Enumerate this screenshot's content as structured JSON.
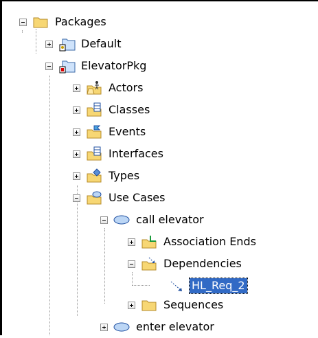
{
  "tree": {
    "nodes": [
      {
        "label": "Packages",
        "toggle": "minus",
        "icon": "folder-icon"
      },
      {
        "label": "Default",
        "toggle": "plus",
        "icon": "package-icon"
      },
      {
        "label": "ElevatorPkg",
        "toggle": "minus",
        "icon": "package-icon"
      },
      {
        "label": "Actors",
        "toggle": "plus",
        "icon": "actors-folder-icon"
      },
      {
        "label": "Classes",
        "toggle": "plus",
        "icon": "classes-folder-icon"
      },
      {
        "label": "Events",
        "toggle": "plus",
        "icon": "events-folder-icon"
      },
      {
        "label": "Interfaces",
        "toggle": "plus",
        "icon": "interfaces-folder-icon"
      },
      {
        "label": "Types",
        "toggle": "plus",
        "icon": "types-folder-icon"
      },
      {
        "label": "Use Cases",
        "toggle": "minus",
        "icon": "usecases-folder-icon"
      },
      {
        "label": "call elevator",
        "toggle": "minus",
        "icon": "usecase-icon"
      },
      {
        "label": "Association Ends",
        "toggle": "plus",
        "icon": "association-ends-folder-icon"
      },
      {
        "label": "Dependencies",
        "toggle": "minus",
        "icon": "dependencies-folder-icon"
      },
      {
        "label": "HL_Req_2",
        "toggle": "none",
        "icon": "dependency-icon",
        "selected": true
      },
      {
        "label": "Sequences",
        "toggle": "plus",
        "icon": "folder-icon"
      },
      {
        "label": "enter elevator",
        "toggle": "plus",
        "icon": "usecase-icon"
      }
    ]
  },
  "colors": {
    "selection": "#316ac5",
    "folder": "#f7d774"
  }
}
